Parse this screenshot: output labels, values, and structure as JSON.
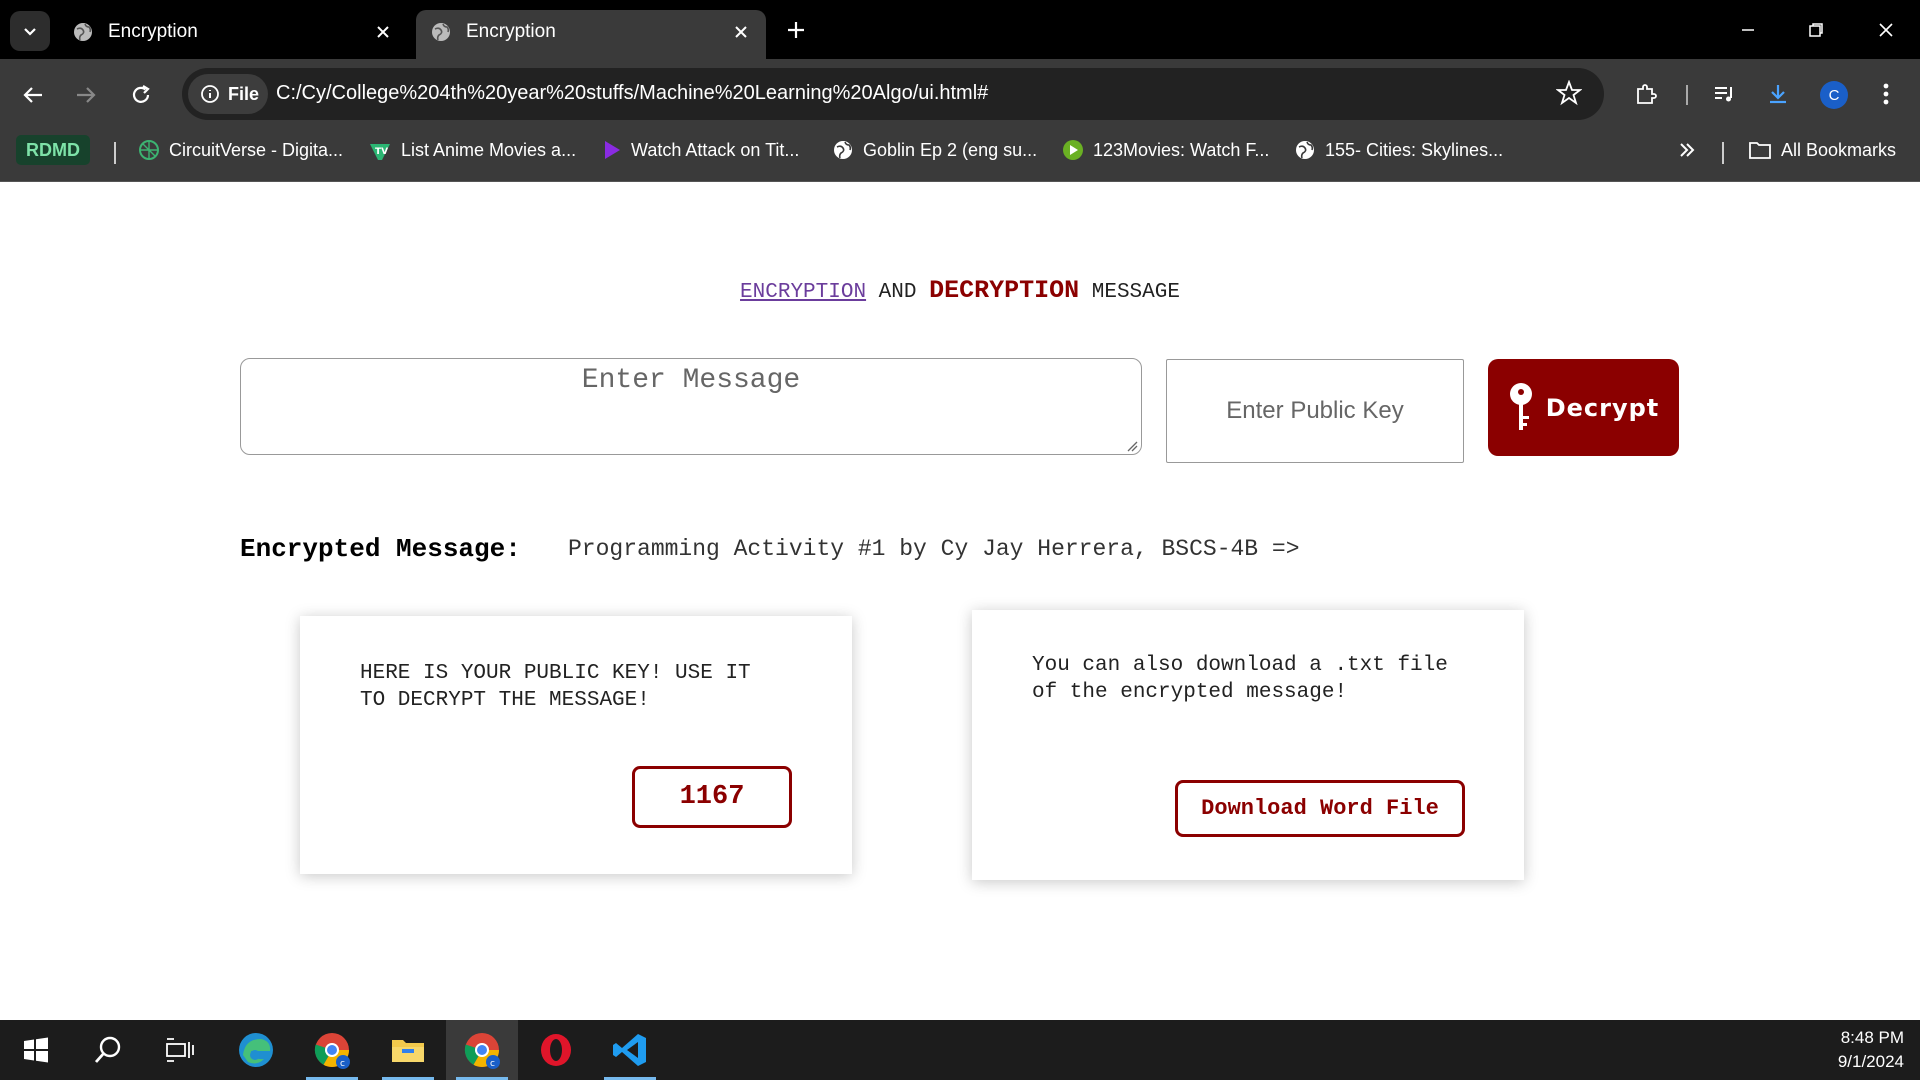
{
  "browser": {
    "tabs": [
      {
        "title": "Encryption",
        "active": false
      },
      {
        "title": "Encryption",
        "active": true
      }
    ],
    "address": {
      "site_info_label": "File",
      "url": "C:/Cy/College%204th%20year%20stuffs/Machine%20Learning%20Algo/ui.html#"
    },
    "profile_initial": "C",
    "bookmarks": {
      "badge": "RDMD",
      "items": [
        {
          "label": "CircuitVerse - Digita...",
          "icon": "circuitverse-icon"
        },
        {
          "label": "List Anime Movies a...",
          "icon": "tv-icon"
        },
        {
          "label": "Watch Attack on Tit...",
          "icon": "play-triangle-icon"
        },
        {
          "label": "Goblin Ep 2 (eng su...",
          "icon": "globe-icon"
        },
        {
          "label": "123Movies: Watch F...",
          "icon": "green-play-icon"
        },
        {
          "label": "155- Cities: Skylines...",
          "icon": "globe-icon"
        }
      ],
      "all_bookmarks_label": "All Bookmarks"
    }
  },
  "page": {
    "heading": {
      "encryption": "ENCRYPTION",
      "and": "AND",
      "decryption": "DECRYPTION",
      "message": "MESSAGE"
    },
    "message_input": {
      "placeholder": "Enter Message",
      "value": ""
    },
    "key_input": {
      "placeholder": "Enter Public Key",
      "value": ""
    },
    "decrypt_button_label": "Decrypt",
    "encrypted": {
      "label": "Encrypted Message:",
      "value": "Programming Activity #1 by Cy Jay Herrera, BSCS-4B =>"
    },
    "key_card": {
      "text": "HERE IS YOUR PUBLIC KEY! USE IT TO DECRYPT THE MESSAGE!",
      "key": "1167"
    },
    "download_card": {
      "text": "You can also download a .txt file of the encrypted message!",
      "button_label": "Download Word File"
    }
  },
  "taskbar": {
    "apps": [
      "start-icon",
      "search-icon",
      "task-view-icon",
      "edge-icon",
      "chrome-icon",
      "file-explorer-icon",
      "chrome-icon",
      "opera-icon",
      "vscode-icon"
    ],
    "time": "8:48 PM",
    "date": "9/1/2024"
  },
  "colors": {
    "accent": "#8b0000",
    "link": "#6b3d9c",
    "browser_dark": "#3a3a3a"
  }
}
